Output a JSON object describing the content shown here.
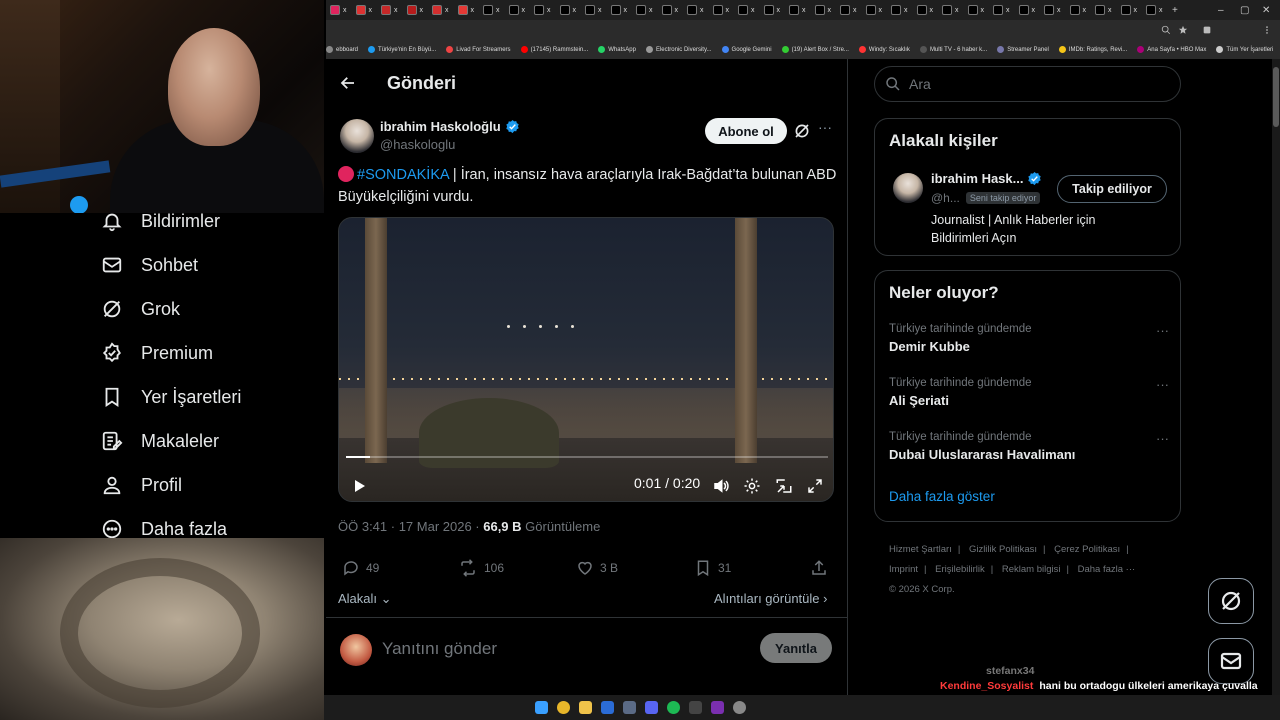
{
  "browser": {
    "tab_close_glyph": "x",
    "bookmarks": [
      "ebboard",
      "Türkiye'nin En Büyü...",
      "Livad For Streamers",
      "(17145) Rammstein...",
      "WhatsApp",
      "Electronic Diversity...",
      "Google Gemini",
      "(19) Alert Box / Stre...",
      "Windy: Sıcaklık",
      "Multi TV - 6 haber k...",
      "Streamer Panel",
      "IMDb: Ratings, Revi...",
      "Ana Sayfa • HBO Max",
      "Tüm Yer İşaretleri"
    ]
  },
  "nav": {
    "items": [
      {
        "label": "Bildirimler",
        "icon": "bell-icon"
      },
      {
        "label": "Sohbet",
        "icon": "mail-icon"
      },
      {
        "label": "Grok",
        "icon": "grok-icon"
      },
      {
        "label": "Premium",
        "icon": "premium-badge-icon"
      },
      {
        "label": "Yer İşaretleri",
        "icon": "bookmark-icon"
      },
      {
        "label": "Makaleler",
        "icon": "article-icon"
      },
      {
        "label": "Profil",
        "icon": "profile-icon"
      },
      {
        "label": "Daha fazla",
        "icon": "more-circle-icon"
      }
    ]
  },
  "header": {
    "title": "Gönderi"
  },
  "post": {
    "author_name": "ibrahim Haskoloğlu",
    "author_handle": "@haskologlu",
    "follow_label": "Abone ol",
    "hashtag": "#SONDAKİKA",
    "text_line": " |  İran, insansız hava araçlarıyla Irak-Bağdat’ta bulunan ABD Büyükelçiliğini vurdu.",
    "video_time": "0:01 / 0:20",
    "video_progress": 0.05,
    "time": "ÖÖ 3:41 · 17 Mar 2026 · ",
    "views_count": "66,9 B",
    "views_label": " Görüntüleme",
    "replies": "49",
    "reposts": "106",
    "likes": "3 B",
    "bookmarks": "31",
    "related_label": "Alakalı",
    "quotes_label": "Alıntıları görüntüle",
    "reply_placeholder": "Yanıtını gönder",
    "reply_button": "Yanıtla"
  },
  "sidebar": {
    "search_placeholder": "Ara",
    "related_title": "Alakalı kişiler",
    "related_user": {
      "name": "ibrahim Hask...",
      "handle": "@h...",
      "follows_you": "Seni takip ediyor",
      "bio": "Journalist | Anlık Haberler için Bildirimleri Açın",
      "following_label": "Takip ediliyor"
    },
    "trends_title": "Neler oluyor?",
    "trends": [
      {
        "context": "Türkiye tarihinde gündemde",
        "name": "Demir Kubbe"
      },
      {
        "context": "Türkiye tarihinde gündemde",
        "name": "Ali Şeriati"
      },
      {
        "context": "Türkiye tarihinde gündemde",
        "name": "Dubai Uluslararası Havalimanı"
      }
    ],
    "show_more": "Daha fazla göster",
    "footer_links": [
      "Hizmet Şartları",
      "Gizlilik Politikası",
      "Çerez Politikası",
      "Imprint",
      "Erişilebilirlik",
      "Reklam bilgisi",
      "Daha fazla ···"
    ],
    "copyright": "© 2026 X Corp."
  },
  "chat": {
    "user1": "stefanx34",
    "user2": "Kendine_Sosyalist",
    "message": "hani bu ortadogu ülkeleri amerikaya çuvalla para veiyordu bizi koru diye ne oldu o paralara"
  },
  "colors": {
    "accent": "#1d9bf0",
    "verified": "#1d9bf0",
    "breaking": "#e0245e"
  }
}
